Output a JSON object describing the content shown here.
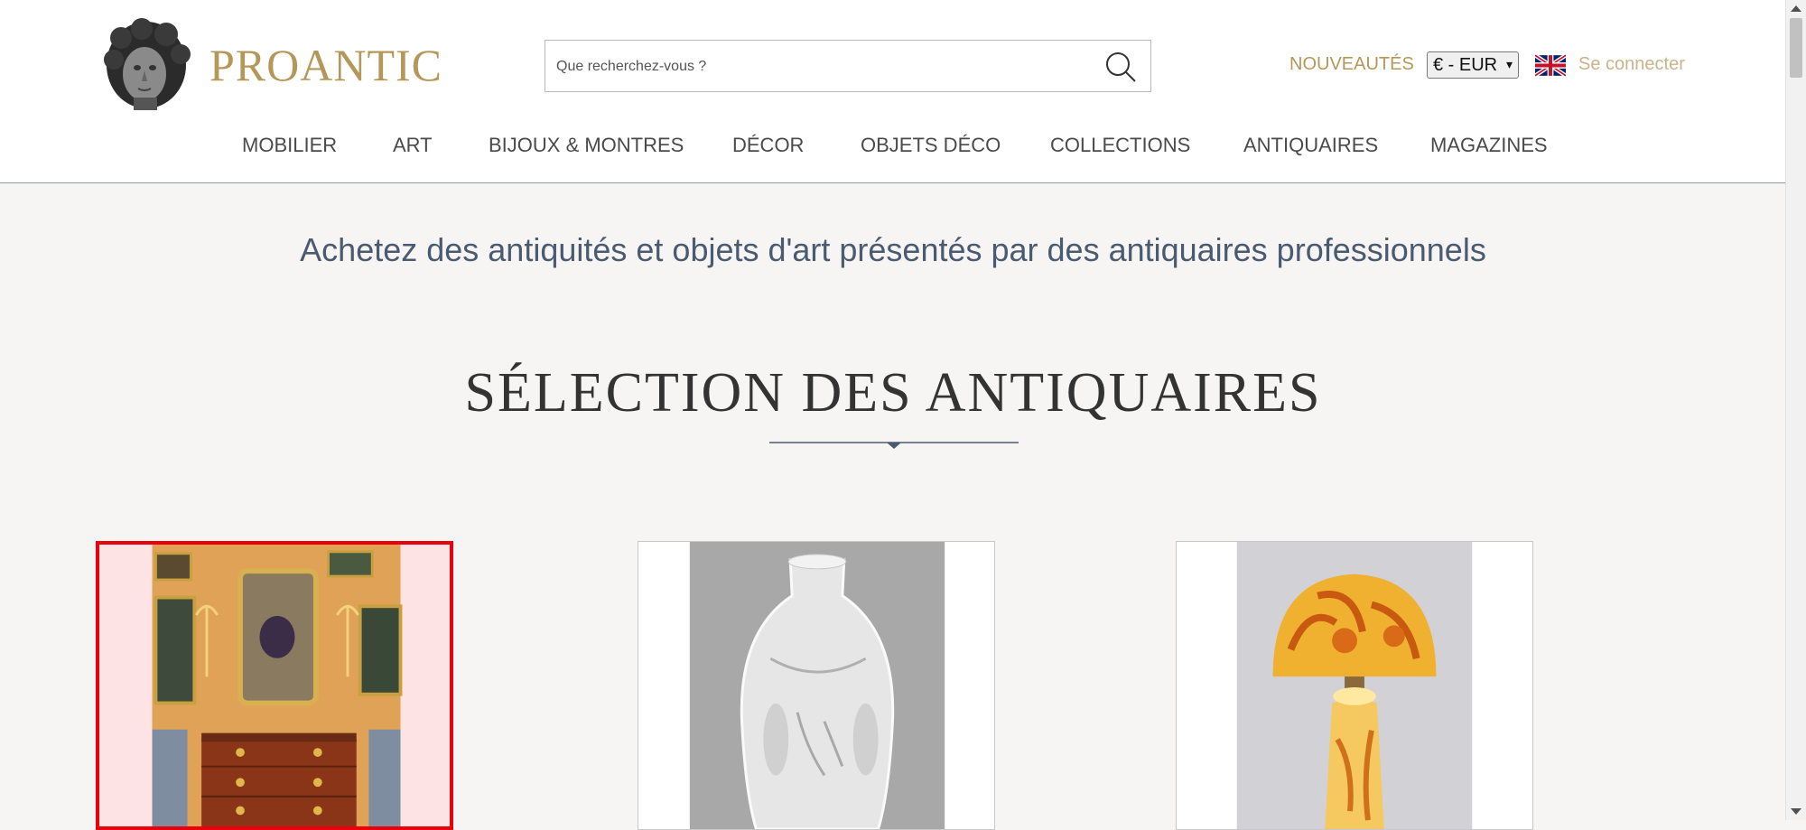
{
  "brand": {
    "name": "PROANTIC",
    "color": "#b5975a"
  },
  "search": {
    "placeholder": "Que recherchez-vous ?",
    "icon": "search-icon"
  },
  "header": {
    "nouveautes": "NOUVEAUTÉS",
    "currency": "€ - EUR",
    "language_flag": "uk-flag-icon",
    "login": "Se connecter"
  },
  "nav": {
    "items": [
      {
        "label": "MOBILIER"
      },
      {
        "label": "ART"
      },
      {
        "label": "BIJOUX & MONTRES"
      },
      {
        "label": "DÉCOR"
      },
      {
        "label": "OBJETS DÉCO"
      },
      {
        "label": "COLLECTIONS"
      },
      {
        "label": "ANTIQUAIRES"
      },
      {
        "label": "MAGAZINES"
      }
    ]
  },
  "main": {
    "tagline": "Achetez des antiquités et objets d'art présentés par des antiquaires professionnels",
    "section_title": "SÉLECTION DES ANTIQUAIRES",
    "cards": [
      {
        "image": "antique-salon-commode-image",
        "selected": true
      },
      {
        "image": "crystal-vase-image",
        "selected": false
      },
      {
        "image": "art-nouveau-lamp-image",
        "selected": false
      }
    ]
  },
  "colors": {
    "accent_gold": "#b5975a",
    "tagline_blue": "#4a5a70",
    "selection_red": "#e8000a"
  }
}
